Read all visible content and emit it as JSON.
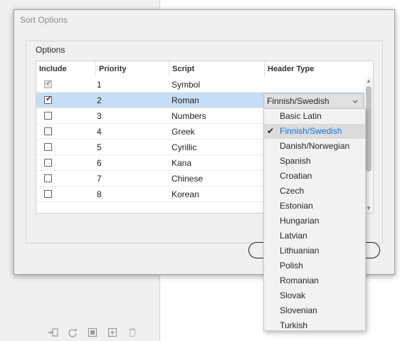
{
  "dialog": {
    "title": "Sort Options",
    "group_label": "Options"
  },
  "table": {
    "headers": {
      "include": "Include",
      "priority": "Priority",
      "script": "Script",
      "header_type": "Header Type"
    },
    "rows": [
      {
        "checked": true,
        "disabled": true,
        "priority": "1",
        "script": "Symbol",
        "header_type": ""
      },
      {
        "checked": true,
        "disabled": false,
        "priority": "2",
        "script": "Roman",
        "header_type": "Finnish/Swedish",
        "selected": true
      },
      {
        "checked": false,
        "disabled": false,
        "priority": "3",
        "script": "Numbers",
        "header_type": ""
      },
      {
        "checked": false,
        "disabled": false,
        "priority": "4",
        "script": "Greek",
        "header_type": ""
      },
      {
        "checked": false,
        "disabled": false,
        "priority": "5",
        "script": "Cyrillic",
        "header_type": ""
      },
      {
        "checked": false,
        "disabled": false,
        "priority": "6",
        "script": "Kana",
        "header_type": ""
      },
      {
        "checked": false,
        "disabled": false,
        "priority": "7",
        "script": "Chinese",
        "header_type": ""
      },
      {
        "checked": false,
        "disabled": false,
        "priority": "8",
        "script": "Korean",
        "header_type": ""
      }
    ]
  },
  "combo": {
    "value": "Finnish/Swedish"
  },
  "dropdown": {
    "selected": "Finnish/Swedish",
    "options": [
      "Basic Latin",
      "Finnish/Swedish",
      "Danish/Norwegian",
      "Spanish",
      "Croatian",
      "Czech",
      "Estonian",
      "Hungarian",
      "Latvian",
      "Lithuanian",
      "Polish",
      "Romanian",
      "Slovak",
      "Slovenian",
      "Turkish"
    ]
  },
  "colors": {
    "selected_row": "#c7dcf5",
    "selected_option_text": "#1473e6"
  },
  "icons": {
    "checkmark": "checkmark-icon",
    "combo_arrow": "chevron-down-icon",
    "toolbar": [
      "new-from-icon",
      "refresh-icon",
      "update-icon",
      "new-icon",
      "trash-icon"
    ]
  }
}
